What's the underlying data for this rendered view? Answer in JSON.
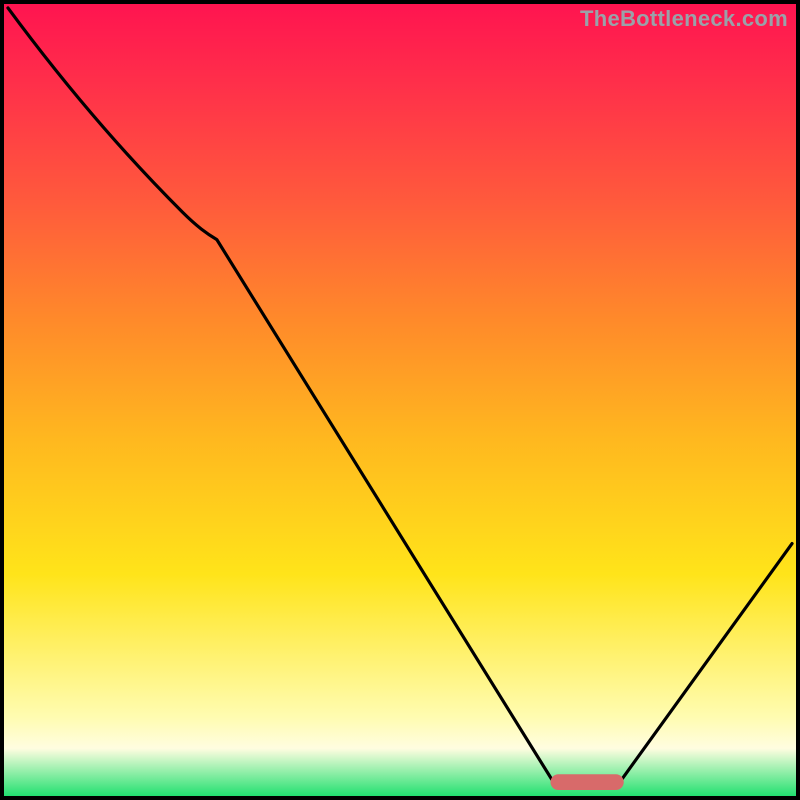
{
  "watermark": "TheBottleneck.com",
  "chart_data": {
    "type": "line",
    "title": "",
    "xlabel": "",
    "ylabel": "",
    "xlim": [
      0,
      100
    ],
    "ylim": [
      0,
      100
    ],
    "x": [
      0,
      15,
      25,
      68,
      78,
      100
    ],
    "values": [
      100,
      80,
      72,
      0,
      0,
      30
    ],
    "series": [
      {
        "name": "bottleneck-curve",
        "x": [
          0,
          15,
          25,
          68,
          78,
          100
        ],
        "y": [
          100,
          80,
          72,
          0,
          0,
          30
        ]
      }
    ],
    "marker": {
      "x_range": [
        68,
        78
      ],
      "y": 0,
      "color": "#d86a6a"
    },
    "background_gradient": {
      "stops": [
        {
          "pos": 0,
          "color": "#ff1450"
        },
        {
          "pos": 25,
          "color": "#ff5a3c"
        },
        {
          "pos": 55,
          "color": "#ffb81f"
        },
        {
          "pos": 90,
          "color": "#fffcb0"
        },
        {
          "pos": 100,
          "color": "#22e070"
        }
      ]
    }
  }
}
